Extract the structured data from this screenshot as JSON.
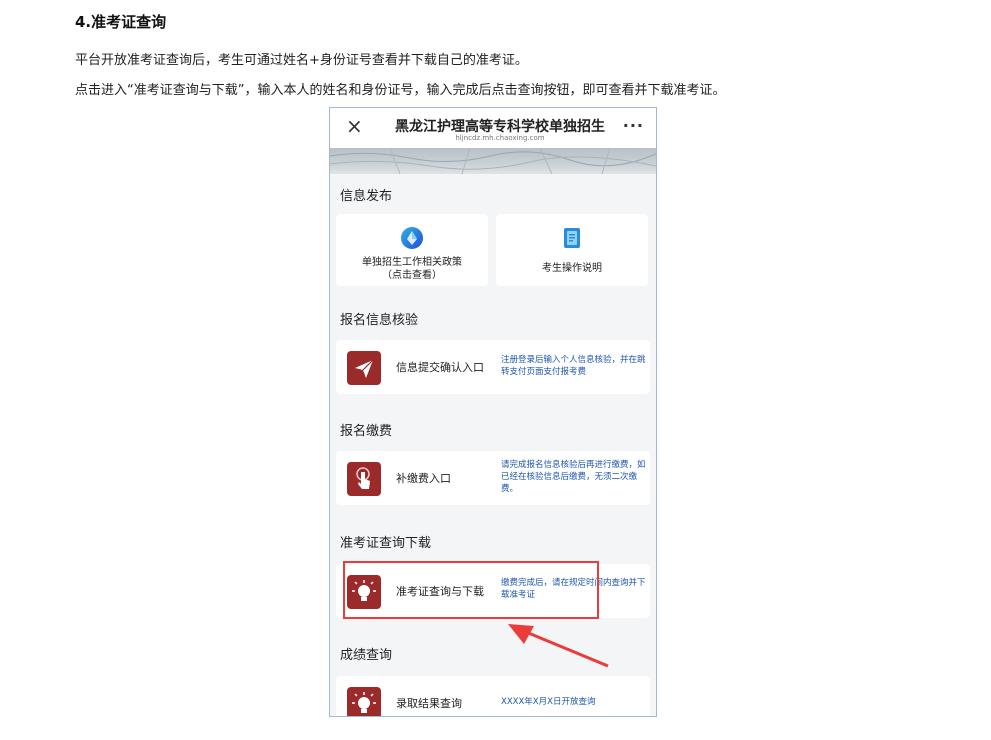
{
  "doc": {
    "heading": "4.准考证查询",
    "paragraph1": "平台开放准考证查询后，考生可通过姓名+身份证号查看并下载自己的准考证。",
    "paragraph2": "点击进入“准考证查询与下载”，输入本人的姓名和身份证号，输入完成后点击查询按钮，即可查看并下载准考证。"
  },
  "phone": {
    "close_icon": "×",
    "title": "黑龙江护理高等专科学校单独招生",
    "url": "hljncdz.mh.chaoxing.com",
    "more_icon": "···",
    "sections": {
      "info_release": {
        "title": "信息发布",
        "card_policy_line1": "单独招生工作相关政策",
        "card_policy_line2": "（点击查看）",
        "card_guide": "考生操作说明"
      },
      "verify": {
        "title": "报名信息核验",
        "label": "信息提交确认入口",
        "note": "注册登录后输入个人信息核验，并在跳转支付页面支付报考费"
      },
      "payment": {
        "title": "报名缴费",
        "label": "补缴费入口",
        "note": "请完成报名信息核验后再进行缴费，如已经在核验信息后缴费，无须二次缴费。"
      },
      "admission": {
        "title": "准考证查询下载",
        "label": "准考证查询与下载",
        "note": "缴费完成后，请在规定时间内查询并下载准考证"
      },
      "score": {
        "title": "成绩查询",
        "label": "录取结果查询",
        "note": "XXXX年X月X日开放查询"
      }
    }
  },
  "colors": {
    "icon_red": "#9b2b2b",
    "note_blue": "#1e56b0",
    "highlight_red": "#ec3b3b"
  }
}
